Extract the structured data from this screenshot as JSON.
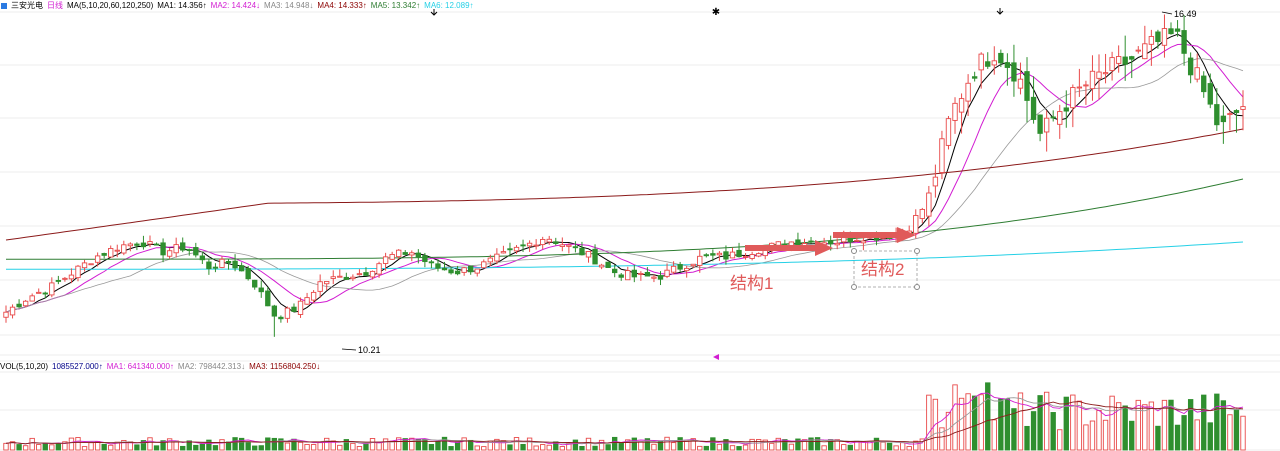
{
  "header": {
    "stock_name": "三安光电",
    "period": "日线",
    "ma_params": "MA(5,10,20,60,120,250)",
    "ma_values": [
      {
        "text": "MA1: 14.356↑",
        "color": "#000000"
      },
      {
        "text": "MA2: 14.424↓",
        "color": "#d21dd2"
      },
      {
        "text": "MA3: 14.948↓",
        "color": "#888888"
      },
      {
        "text": "MA4: 14.333↑",
        "color": "#8b0000"
      },
      {
        "text": "MA5: 13.342↑",
        "color": "#2e7d32"
      },
      {
        "text": "MA6: 12.089↑",
        "color": "#25d0e6"
      }
    ]
  },
  "volume_header": {
    "params": "VOL(5,10,20)",
    "vol_value": {
      "text": "1085527.000↑",
      "color": "#000088"
    },
    "ma_values": [
      {
        "text": "MA1: 641340.000↑",
        "color": "#d21dd2"
      },
      {
        "text": "MA2: 798442.313↓",
        "color": "#888888"
      },
      {
        "text": "MA3: 1156804.250↓",
        "color": "#8b0000"
      }
    ]
  },
  "annotations": {
    "high_label": "16.49",
    "low_label": "10.21",
    "structure1": "结构1",
    "structure2": "结构2"
  },
  "colors": {
    "up": "#e84a4a",
    "down": "#2f8f2f",
    "grid": "#dcdcdc",
    "ma5": "#000000",
    "ma10": "#d21dd2",
    "ma20": "#999999",
    "ma60": "#8b1a1a",
    "ma120": "#2e7d32",
    "ma250": "#25d0e6",
    "arrow": "#e05a5a"
  },
  "chart_data": {
    "type": "candlestick",
    "price_range": [
      9.85,
      16.65
    ],
    "high": 16.49,
    "low": 10.21,
    "price_key": [
      10.7,
      11.0,
      11.2,
      11.5,
      11.8,
      12.0,
      12.1,
      11.9,
      12.0,
      11.6,
      11.7,
      11.3,
      10.6,
      10.8,
      11.3,
      11.4,
      11.5,
      11.8,
      11.9,
      11.6,
      11.5,
      11.6,
      11.8,
      12.0,
      12.2,
      12.0,
      11.8,
      11.5,
      11.4,
      11.4,
      11.6,
      11.8,
      11.8,
      11.9,
      12.0,
      12.1,
      12.1,
      12.1,
      12.2,
      12.2,
      12.3,
      12.9,
      14.6,
      15.5,
      15.9,
      15.4,
      14.2,
      14.8,
      15.2,
      15.5,
      15.7,
      16.0,
      16.2,
      15.3,
      14.3,
      14.8
    ],
    "volume_range": [
      0,
      1400000
    ]
  }
}
